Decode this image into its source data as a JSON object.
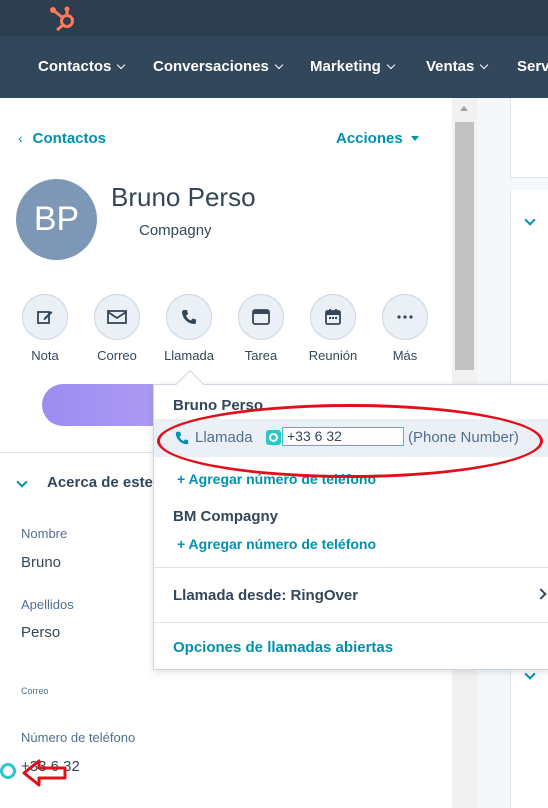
{
  "nav": {
    "items": [
      {
        "label": "Contactos"
      },
      {
        "label": "Conversaciones"
      },
      {
        "label": "Marketing"
      },
      {
        "label": "Ventas"
      },
      {
        "label": "Serv"
      }
    ]
  },
  "header": {
    "back_label": "Contactos",
    "actions_label": "Acciones"
  },
  "contact": {
    "initials": "BP",
    "name": "Bruno Perso",
    "company": "Compagny"
  },
  "quick_actions": [
    {
      "label": "Nota",
      "icon": "note-icon"
    },
    {
      "label": "Correo",
      "icon": "mail-icon"
    },
    {
      "label": "Llamada",
      "icon": "phone-icon"
    },
    {
      "label": "Tarea",
      "icon": "task-icon"
    },
    {
      "label": "Reunión",
      "icon": "calendar-icon"
    },
    {
      "label": "Más",
      "icon": "more-icon"
    }
  ],
  "about": {
    "title": "Acerca de este contacto",
    "fields": {
      "first_name_label": "Nombre",
      "first_name_value": "Bruno",
      "last_name_label": "Apellidos",
      "last_name_value": "Perso",
      "email_label": "Correo",
      "phone_label": "Número de teléfono",
      "phone_value": "+33 6 32"
    }
  },
  "call_popup": {
    "contact_section": "Bruno Perso",
    "call_label": "Llamada",
    "phone_number": "+33 6 32",
    "phone_type": "(Phone Number)",
    "add_phone_1": "+ Agregar número de teléfono",
    "company_section": "BM Compagny",
    "add_phone_2": "+ Agregar número de teléfono",
    "call_from": "Llamada desde: RingOver",
    "open_call_options": "Opciones de llamadas abiertas"
  },
  "colors": {
    "topbar": "#2d3e50",
    "navbar": "#33475b",
    "link": "#0091ae",
    "avatar": "#7c98b6",
    "ringover": "#2fc5c9",
    "annotation_red": "#e0101a",
    "hubspot_orange": "#ff7a59"
  }
}
